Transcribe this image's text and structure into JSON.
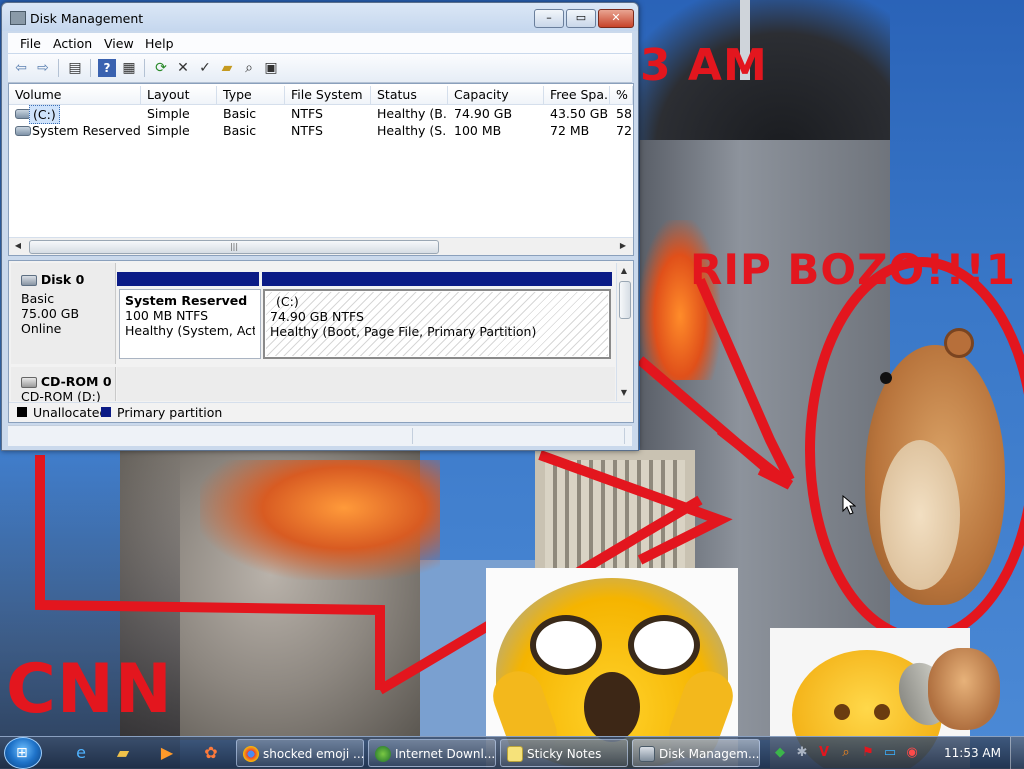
{
  "wallpaper": {
    "texts": {
      "time": "3 AM",
      "rip": "RIP BOZO!!!1",
      "cnn": "CNN"
    }
  },
  "window": {
    "title": "Disk Management",
    "controls": {
      "minimize": "–",
      "maximize": "▭",
      "close": "✕"
    },
    "menu": [
      "File",
      "Action",
      "View",
      "Help"
    ],
    "volume_columns": [
      "Volume",
      "Layout",
      "Type",
      "File System",
      "Status",
      "Capacity",
      "Free Spa...",
      "% F"
    ],
    "volumes": [
      {
        "volume": "(C:)",
        "layout": "Simple",
        "type": "Basic",
        "fs": "NTFS",
        "status": "Healthy (B...",
        "capacity": "74.90 GB",
        "free": "43.50 GB",
        "pct": "58"
      },
      {
        "volume": "System Reserved",
        "layout": "Simple",
        "type": "Basic",
        "fs": "NTFS",
        "status": "Healthy (S...",
        "capacity": "100 MB",
        "free": "72 MB",
        "pct": "72"
      }
    ],
    "disks": [
      {
        "name": "Disk 0",
        "type": "Basic",
        "size": "75.00 GB",
        "state": "Online",
        "partitions": [
          {
            "name": "System Reserved",
            "size": "100 MB NTFS",
            "status": "Healthy (System, Active,"
          },
          {
            "name": "(C:)",
            "size": "74.90 GB NTFS",
            "status": "Healthy (Boot, Page File, Primary Partition)"
          }
        ]
      },
      {
        "name": "CD-ROM 0",
        "type": "CD-ROM (D:)"
      }
    ],
    "legend": [
      {
        "label": "Unallocated",
        "color": "#000000"
      },
      {
        "label": "Primary partition",
        "color": "#0b1b86"
      }
    ]
  },
  "taskbar": {
    "tasks": [
      {
        "label": "shocked emoji ...",
        "icon": "chrome-icon"
      },
      {
        "label": "Internet Downl...",
        "icon": "internet-download-manager-icon"
      },
      {
        "label": "Sticky Notes",
        "icon": "sticky-notes-icon"
      },
      {
        "label": "Disk Managem...",
        "icon": "disk-management-icon",
        "active": true
      }
    ],
    "clock": "11:53 AM"
  },
  "colors": {
    "accent_red": "#e3161e",
    "primary_partition": "#0b1b86",
    "taskbar": "#2a3b56"
  }
}
